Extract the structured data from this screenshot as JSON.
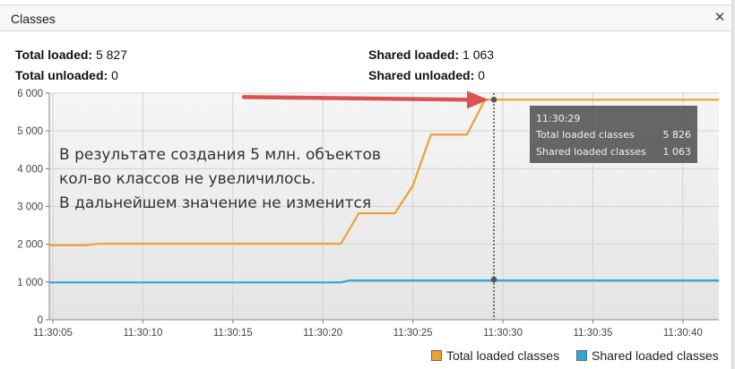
{
  "window": {
    "title": "Classes"
  },
  "stats": {
    "total_loaded_label": "Total loaded:",
    "total_loaded_value": "5 827",
    "total_unloaded_label": "Total unloaded:",
    "total_unloaded_value": "0",
    "shared_loaded_label": "Shared loaded:",
    "shared_loaded_value": "1 063",
    "shared_unloaded_label": "Shared unloaded:",
    "shared_unloaded_value": "0"
  },
  "annotation": {
    "lines": [
      "В результате создания 5 млн. объектов",
      "кол-во классов не увеличилось.",
      "В дальнейшем значение не изменится"
    ],
    "arrow_color": "#d9534f"
  },
  "tooltip": {
    "time": "11:30:29",
    "rows": [
      {
        "label": "Total loaded classes",
        "value": "5 826"
      },
      {
        "label": "Shared loaded classes",
        "value": "1 063"
      }
    ]
  },
  "legend": [
    {
      "label": "Total loaded classes",
      "color": "#f0a030"
    },
    {
      "label": "Shared loaded classes",
      "color": "#2aa8d8"
    }
  ],
  "chart_data": {
    "type": "line",
    "x_ticks": [
      "11:30:05",
      "11:30:10",
      "11:30:15",
      "11:30:20",
      "11:30:25",
      "11:30:30",
      "11:30:35",
      "11:30:40"
    ],
    "y_ticks": [
      "0",
      "1 000",
      "2 000",
      "3 000",
      "4 000",
      "5 000",
      "6 000"
    ],
    "ylim": [
      0,
      6000
    ],
    "xlim_seconds_after_11_30_00": [
      4.8,
      42.0
    ],
    "cursor_time_seconds": 29.5,
    "grid": true,
    "series": [
      {
        "name": "Total loaded classes",
        "color": "#f0a030",
        "x": [
          4.8,
          6.8,
          7.5,
          21.0,
          22.0,
          24.0,
          25.0,
          26.0,
          28.0,
          29.0,
          42.0
        ],
        "y": [
          1970,
          1970,
          2010,
          2010,
          2820,
          2820,
          3550,
          4900,
          4900,
          5826,
          5827
        ]
      },
      {
        "name": "Shared loaded classes",
        "color": "#2aa8d8",
        "x": [
          4.8,
          21.0,
          21.5,
          42.0
        ],
        "y": [
          990,
          990,
          1040,
          1040
        ]
      }
    ]
  }
}
